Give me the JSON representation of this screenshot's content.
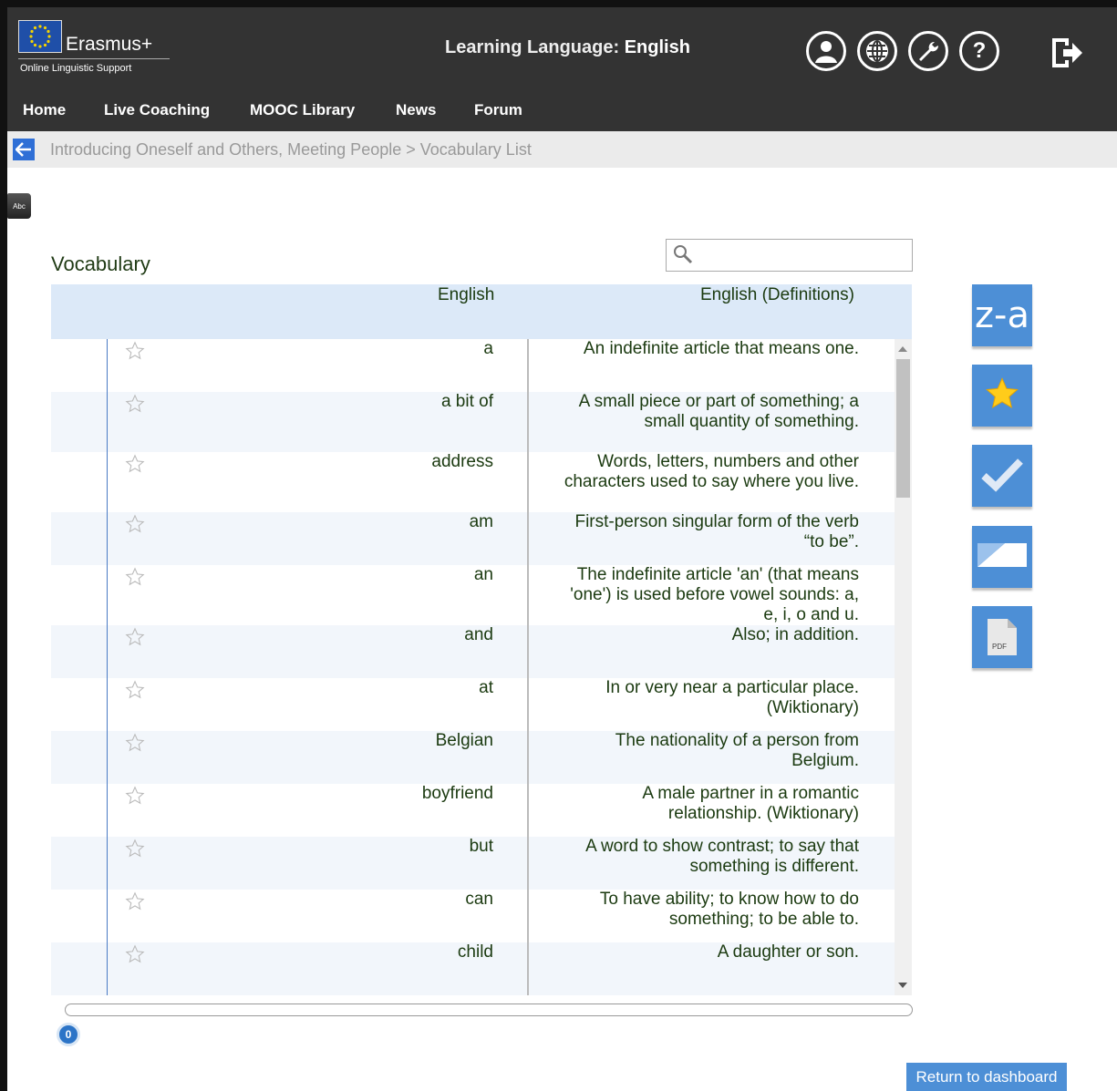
{
  "header": {
    "brand_name": "Erasmus+",
    "brand_sub": "Online Linguistic Support",
    "learning_label": "Learning Language:",
    "learning_value": "English",
    "icons": [
      "user-icon",
      "globe-icon",
      "wrench-icon",
      "help-icon",
      "logout-icon"
    ]
  },
  "nav": {
    "items": [
      "Home",
      "Live Coaching",
      "MOOC Library",
      "News",
      "Forum"
    ]
  },
  "breadcrumb": {
    "text": "Introducing Oneself and Others, Meeting People  >  Vocabulary List"
  },
  "book_label": "Abc",
  "vocabulary": {
    "title": "Vocabulary",
    "search_value": "",
    "col_word": "English",
    "col_def": "English (Definitions)",
    "rows": [
      {
        "word": "a",
        "def": "An indefinite article that means one."
      },
      {
        "word": "a bit of",
        "def": "A small piece or part of something; a small quantity of something."
      },
      {
        "word": "address",
        "def": "Words, letters, numbers and other characters used to say where you live."
      },
      {
        "word": "am",
        "def": "First-person singular form of the verb “to be”."
      },
      {
        "word": "an",
        "def": "The indefinite article 'an' (that means 'one') is used before vowel sounds: a, e, i, o and u."
      },
      {
        "word": "and",
        "def": "Also; in addition."
      },
      {
        "word": "at",
        "def": "In or very near a particular place. (Wiktionary)"
      },
      {
        "word": "Belgian",
        "def": "The nationality of a person from Belgium."
      },
      {
        "word": "boyfriend",
        "def": "A male partner in a romantic relationship. (Wiktionary)"
      },
      {
        "word": "but",
        "def": "A word to show contrast; to say that something is different."
      },
      {
        "word": "can",
        "def": "To have ability; to know how to do something; to be able to."
      },
      {
        "word": "child",
        "def": "A daughter or son."
      }
    ]
  },
  "side_buttons": {
    "sort_label": "z-a",
    "pdf_label": "PDF"
  },
  "progress": {
    "value": 0,
    "label": "0"
  },
  "footer": {
    "return_label": "Return to dashboard"
  },
  "colors": {
    "topbar": "#333333",
    "accent": "#4d8fd6",
    "header_row": "#dce9f8",
    "text_green": "#1b3a10"
  }
}
